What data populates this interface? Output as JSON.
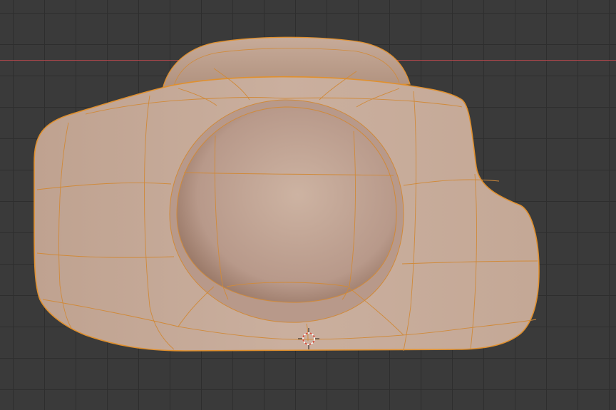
{
  "viewport": {
    "background_color": "#3a3a3a",
    "grid_line_color": "#2e2e2e"
  },
  "axis": {
    "x_axis_color": "#b5474d"
  },
  "mesh": {
    "surface_color": "#c9ae9d",
    "surface_shadow_color": "#9c7a66",
    "selected_outline_color": "#e0902e",
    "wire_color": "#d08a3a"
  },
  "cursor": {
    "icon": "3d-cursor-icon",
    "ring_color_a": "#d94a3a",
    "ring_color_b": "#ffffff"
  }
}
